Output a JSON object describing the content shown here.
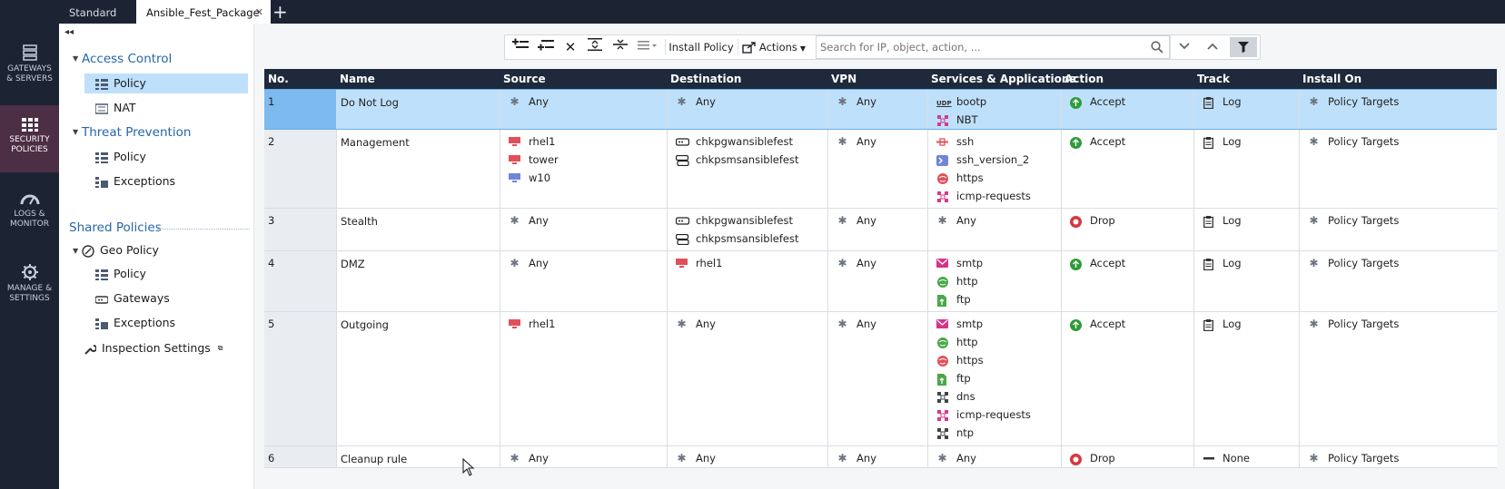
{
  "tabs": [
    {
      "label": "Standard"
    },
    {
      "label": "Ansible_Fest_Package",
      "active": true
    }
  ],
  "rail": [
    {
      "label1": "GATEWAYS",
      "label2": "& SERVERS",
      "icon": "gateways-icon"
    },
    {
      "label1": "SECURITY",
      "label2": "POLICIES",
      "icon": "security-policies-icon",
      "active": true
    },
    {
      "label1": "LOGS &",
      "label2": "MONITOR",
      "icon": "logs-monitor-icon"
    },
    {
      "label1": "MANAGE &",
      "label2": "SETTINGS",
      "icon": "gear-icon"
    }
  ],
  "tree": {
    "access_control": "Access Control",
    "ac_policy": "Policy",
    "ac_nat": "NAT",
    "threat_prevention": "Threat Prevention",
    "tp_policy": "Policy",
    "tp_exceptions": "Exceptions",
    "shared_policies": "Shared Policies",
    "geo_policy": "Geo Policy",
    "geo_policy_item": "Policy",
    "geo_gateways": "Gateways",
    "geo_exceptions": "Exceptions",
    "inspection_settings": "Inspection Settings"
  },
  "toolbar": {
    "install_policy": "Install Policy",
    "actions": "Actions",
    "search_placeholder": "Search for IP, object, action, ..."
  },
  "columns": [
    "No.",
    "Name",
    "Source",
    "Destination",
    "VPN",
    "Services & Applications",
    "Action",
    "Track",
    "Install On"
  ],
  "rules": [
    {
      "no": "1",
      "name": "Do Not Log",
      "source": [
        {
          "t": "Any",
          "i": "any"
        }
      ],
      "destination": [
        {
          "t": "Any",
          "i": "any"
        }
      ],
      "vpn": "Any",
      "services": [
        {
          "t": "bootp",
          "i": "udp"
        },
        {
          "t": "NBT",
          "i": "group"
        }
      ],
      "action": "Accept",
      "action_type": "accept",
      "track": "Log",
      "install_on": "Policy Targets"
    },
    {
      "no": "2",
      "name": "Management",
      "source": [
        {
          "t": "rhel1",
          "i": "host-red"
        },
        {
          "t": "tower",
          "i": "host-red"
        },
        {
          "t": "w10",
          "i": "host-blue"
        }
      ],
      "destination": [
        {
          "t": "chkpgwansiblefest",
          "i": "gateway"
        },
        {
          "t": "chkpsmsansiblefest",
          "i": "server"
        }
      ],
      "vpn": "Any",
      "services": [
        {
          "t": "ssh",
          "i": "ssh"
        },
        {
          "t": "ssh_version_2",
          "i": "ssh2"
        },
        {
          "t": "https",
          "i": "https"
        },
        {
          "t": "icmp-requests",
          "i": "group"
        }
      ],
      "action": "Accept",
      "action_type": "accept",
      "track": "Log",
      "install_on": "Policy Targets"
    },
    {
      "no": "3",
      "name": "Stealth",
      "source": [
        {
          "t": "Any",
          "i": "any"
        }
      ],
      "destination": [
        {
          "t": "chkpgwansiblefest",
          "i": "gateway"
        },
        {
          "t": "chkpsmsansiblefest",
          "i": "server"
        }
      ],
      "vpn": "Any",
      "services": [
        {
          "t": "Any",
          "i": "any"
        }
      ],
      "action": "Drop",
      "action_type": "drop",
      "track": "Log",
      "install_on": "Policy Targets"
    },
    {
      "no": "4",
      "name": "DMZ",
      "source": [
        {
          "t": "Any",
          "i": "any"
        }
      ],
      "destination": [
        {
          "t": "rhel1",
          "i": "host-red"
        }
      ],
      "vpn": "Any",
      "services": [
        {
          "t": "smtp",
          "i": "smtp"
        },
        {
          "t": "http",
          "i": "http"
        },
        {
          "t": "ftp",
          "i": "ftp"
        }
      ],
      "action": "Accept",
      "action_type": "accept",
      "track": "Log",
      "install_on": "Policy Targets"
    },
    {
      "no": "5",
      "name": "Outgoing",
      "source": [
        {
          "t": "rhel1",
          "i": "host-red"
        }
      ],
      "destination": [
        {
          "t": "Any",
          "i": "any"
        }
      ],
      "vpn": "Any",
      "services": [
        {
          "t": "smtp",
          "i": "smtp"
        },
        {
          "t": "http",
          "i": "http"
        },
        {
          "t": "https",
          "i": "https"
        },
        {
          "t": "ftp",
          "i": "ftp"
        },
        {
          "t": "dns",
          "i": "group-dark"
        },
        {
          "t": "icmp-requests",
          "i": "group"
        },
        {
          "t": "ntp",
          "i": "group-dark"
        }
      ],
      "action": "Accept",
      "action_type": "accept",
      "track": "Log",
      "install_on": "Policy Targets"
    },
    {
      "no": "6",
      "name": "Cleanup rule",
      "source": [
        {
          "t": "Any",
          "i": "any"
        }
      ],
      "destination": [
        {
          "t": "Any",
          "i": "any"
        }
      ],
      "vpn": "Any",
      "services": [
        {
          "t": "Any",
          "i": "any"
        }
      ],
      "action": "Drop",
      "action_type": "drop",
      "track": "None",
      "track_type": "none",
      "install_on": "Policy Targets"
    }
  ],
  "colors": {
    "accept": "#2e9b3a",
    "drop": "#d8363c",
    "header_bg": "#1e2a3c",
    "selected_row": "#bfe0fb",
    "rail_bg": "#1c2433",
    "rail_active": "#4c2e45"
  }
}
